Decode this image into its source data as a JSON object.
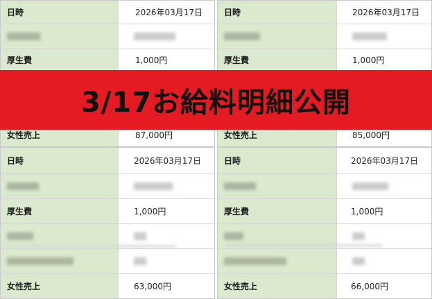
{
  "labels": {
    "datetime": "日時",
    "welfare": "厚生費",
    "sales": "女性売上"
  },
  "banner": {
    "text": "3/17お給料明細公開"
  },
  "panels": [
    {
      "date": "2026年03月17日",
      "welfare": "1,000円",
      "sales": "87,000円"
    },
    {
      "date": "2026年03月17日",
      "welfare": "1,000円",
      "sales": "85,000円"
    },
    {
      "date": "2026年03月17日",
      "welfare": "1,000円",
      "sales": "63,000円"
    },
    {
      "date": "2026年03月17日",
      "welfare": "1,000円",
      "sales": "66,000円"
    }
  ],
  "colors": {
    "label_bg": "#dbe9cf",
    "banner_bg": "#e41b23"
  }
}
